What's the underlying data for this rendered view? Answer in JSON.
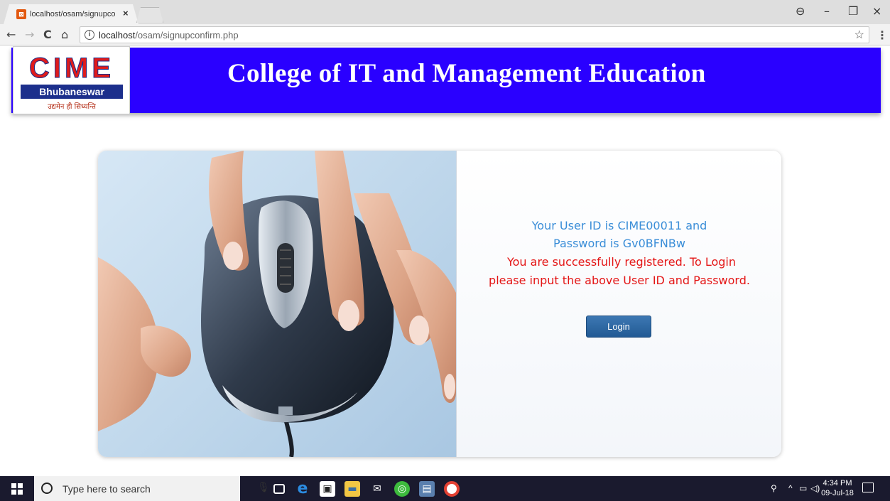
{
  "browser": {
    "tab_title": "localhost/osam/signupco",
    "tab_close": "×",
    "url_host": "localhost",
    "url_path": "/osam/signupconfirm.php",
    "back_icon": "←",
    "forward_icon": "→",
    "reload_icon": "C",
    "home_icon": "⌂",
    "info_icon": "i",
    "star_icon": "☆",
    "menu_icon": "⋮",
    "profile_icon": "⊖",
    "minimize_icon": "–",
    "restore_icon": "❐",
    "close_icon": "×"
  },
  "banner": {
    "logo_main": "CIME",
    "logo_sub": "Bhubaneswar",
    "logo_tagline": "उद्यमेन ही सिध्यन्ति",
    "title": "College of IT and Management Education",
    "background_color": "#2a00ff"
  },
  "confirmation": {
    "user_id_line": "Your User ID is CIME00011 and",
    "password_line": "Password is Gv0BFNBw",
    "success_line1": "You are successfully registered. To Login",
    "success_line2": "please input the above User ID and Password.",
    "login_button": "Login",
    "info_color": "#3b8ed8",
    "success_color": "#e41616"
  },
  "taskbar": {
    "search_placeholder": "Type here to search",
    "time": "4:34 PM",
    "date": "09-Jul-18",
    "apps": [
      "task-view-icon",
      "edge-icon",
      "store-icon",
      "file-explorer-icon",
      "mail-icon",
      "browser-icon",
      "notepad-icon",
      "chrome-icon"
    ]
  }
}
